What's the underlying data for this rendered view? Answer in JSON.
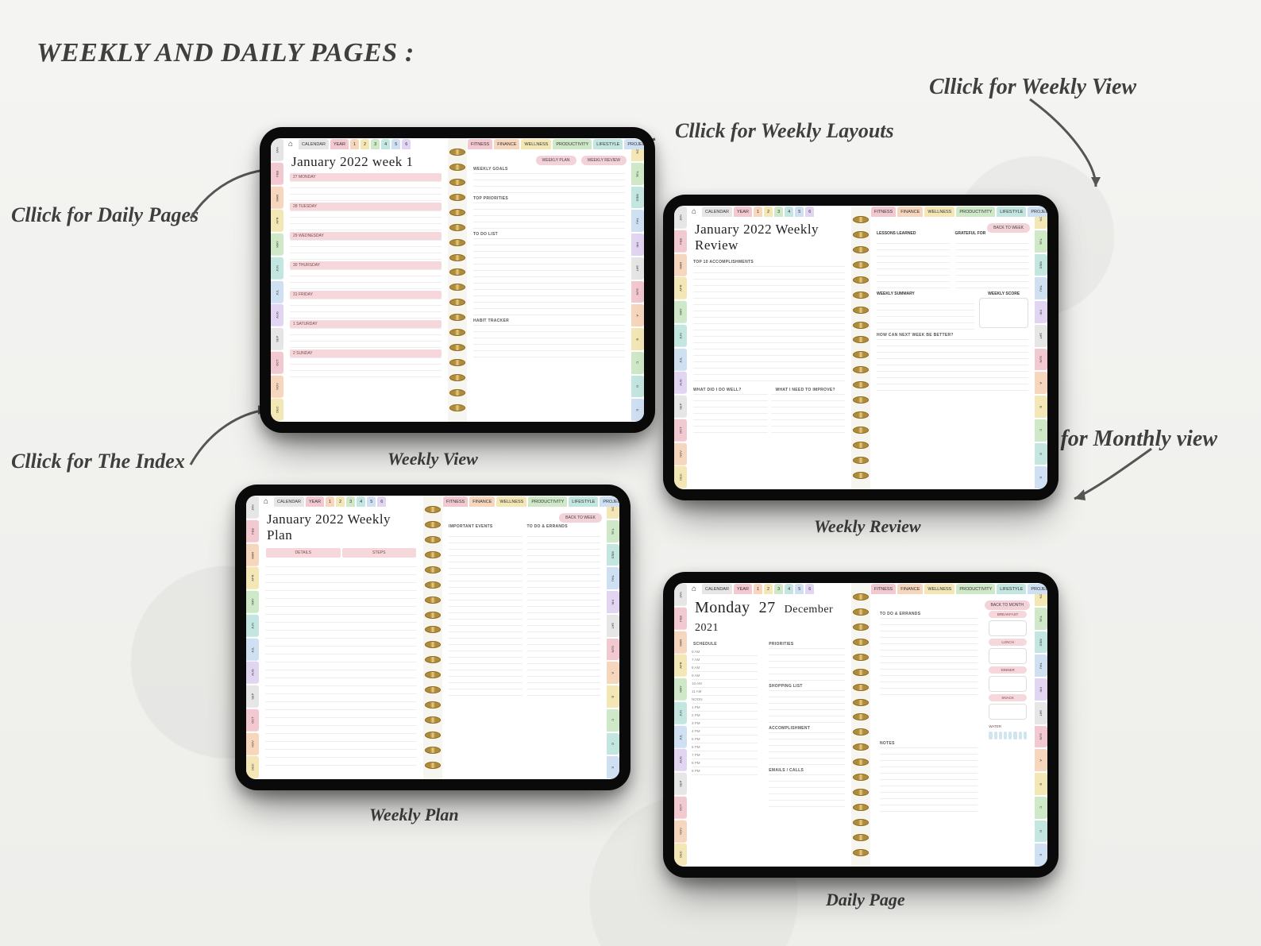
{
  "page_title": "WEEKLY AND DAILY PAGES :",
  "callouts": {
    "daily_pages": "Cllick for Daily Pages",
    "index": "Cllick for The Index",
    "weekly_layouts": "Cllick for Weekly Layouts",
    "weekly_view": "Cllick for Weekly View",
    "monthly_view": "Cllick for Monthly view"
  },
  "captions": {
    "weekly_view": "Weekly View",
    "weekly_review": "Weekly Review",
    "weekly_plan": "Weekly Plan",
    "daily_page": "Daily Page"
  },
  "common": {
    "home_glyph": "⌂",
    "nav_left": [
      "CALENDAR",
      "YEAR",
      "1",
      "2",
      "3",
      "4",
      "5",
      "6"
    ],
    "nav_right": [
      "FITNESS",
      "FINANCE",
      "WELLNESS",
      "PRODUCTIVITY",
      "LIFESTYLE",
      "PROJECTS"
    ],
    "side_tabs_left": [
      "JAN",
      "FEB",
      "MAR",
      "APR",
      "MAY",
      "JUN",
      "JUL",
      "AUG",
      "SEP",
      "OCT",
      "NOV",
      "DEC"
    ],
    "side_tabs_right": [
      "MON",
      "TUE",
      "WED",
      "THU",
      "FRI",
      "SAT",
      "SUN",
      "A",
      "B",
      "C",
      "D",
      "E"
    ]
  },
  "tablet1": {
    "title": "January 2022 week 1",
    "pills": [
      "WEEKLY PLAN",
      "WEEKLY REVIEW"
    ],
    "days": [
      "27 MONDAY",
      "28 TUESDAY",
      "29 WEDNESDAY",
      "30 THURSDAY",
      "31 FRIDAY",
      "1 SATURDAY",
      "2 SUNDAY"
    ],
    "right_sections": [
      "WEEKLY GOALS",
      "TOP PRIORITIES",
      "TO DO LIST",
      "HABIT TRACKER"
    ]
  },
  "tablet2": {
    "title": "January 2022 Weekly Review",
    "back_pill": "BACK TO WEEK",
    "left_sections": [
      "TOP 10 ACCOMPLISHMENTS",
      "WHAT DID I DO WELL?",
      "WHAT I NEED TO IMPROVE?"
    ],
    "right_sections": {
      "lessons": "LESSONS LEARNED",
      "grateful": "GRATEFUL FOR",
      "summary": "WEEKLY SUMMARY",
      "score": "WEEKLY SCORE",
      "next": "HOW CAN NEXT WEEK BE BETTER?"
    }
  },
  "tablet3": {
    "title": "January 2022 Weekly Plan",
    "back_pill": "BACK TO WEEK",
    "cols": [
      "DETAILS",
      "STEPS"
    ],
    "right_sections": [
      "IMPORTANT EVENTS",
      "TO DO & ERRANDS"
    ]
  },
  "tablet4": {
    "title_day": "Monday",
    "title_num": "27",
    "title_rest": "December 2021",
    "back_pill": "BACK TO MONTH",
    "left": {
      "schedule_label": "SCHEDULE",
      "hours": [
        "6 AM",
        "7 AM",
        "8 AM",
        "9 AM",
        "10 AM",
        "11 AM",
        "NOON",
        "1 PM",
        "2 PM",
        "3 PM",
        "4 PM",
        "5 PM",
        "6 PM",
        "7 PM",
        "8 PM",
        "9 PM"
      ],
      "sections": [
        "PRIORITIES",
        "SHOPPING LIST",
        "ACCOMPLISHMENT",
        "EMAILS / CALLS"
      ]
    },
    "right": {
      "todo": "TO DO & ERRANDS",
      "notes": "NOTES",
      "meals": [
        "BREAKFAST",
        "LUNCH",
        "DINNER",
        "SNACK"
      ],
      "water_label": "WATER"
    }
  }
}
